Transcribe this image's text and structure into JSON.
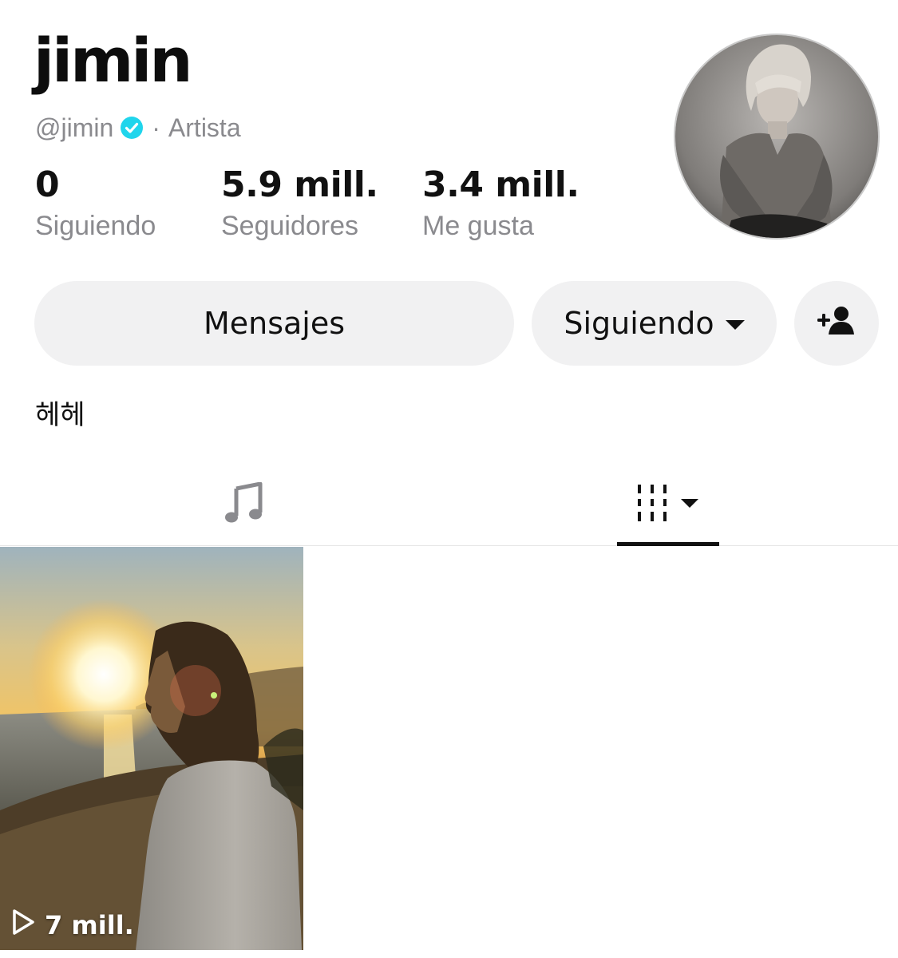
{
  "profile": {
    "display_name": "jimin",
    "handle": "@jimin",
    "separator": "·",
    "category": "Artista",
    "bio": "헤헤"
  },
  "stats": [
    {
      "value": "0",
      "label": "Siguiendo"
    },
    {
      "value": "5.9 mill.",
      "label": "Seguidores"
    },
    {
      "value": "3.4 mill.",
      "label": "Me gusta"
    }
  ],
  "buttons": {
    "messages": "Mensajes",
    "following": "Siguiendo",
    "add_friend_icon": "add-person-icon"
  },
  "tabs": [
    {
      "icon": "music-note-icon",
      "active": false
    },
    {
      "icon": "video-grid-icon",
      "active": true
    }
  ],
  "videos": [
    {
      "views": "7 mill.",
      "icon": "play-outline-icon"
    }
  ],
  "colors": {
    "verified": "#20d5ec",
    "muted_text": "#8a8a8e",
    "button_bg": "#f1f1f2",
    "active_tab": "#111111"
  }
}
